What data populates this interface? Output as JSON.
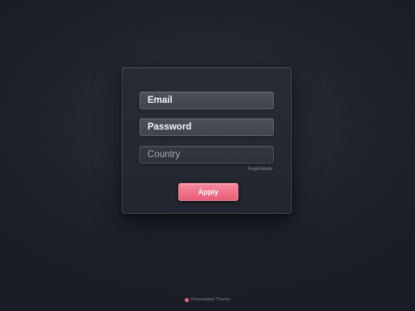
{
  "form": {
    "email_value": "Email",
    "password_value": "Password",
    "country_placeholder": "Country",
    "field_hint": "Forgot details",
    "submit_label": "Apply"
  },
  "footer": {
    "text": "Personalized Themes",
    "icon": "circle-icon"
  },
  "colors": {
    "background": "#1f232d",
    "card": "#262a33",
    "field": "#454a54",
    "accent": "#ef6f86"
  }
}
